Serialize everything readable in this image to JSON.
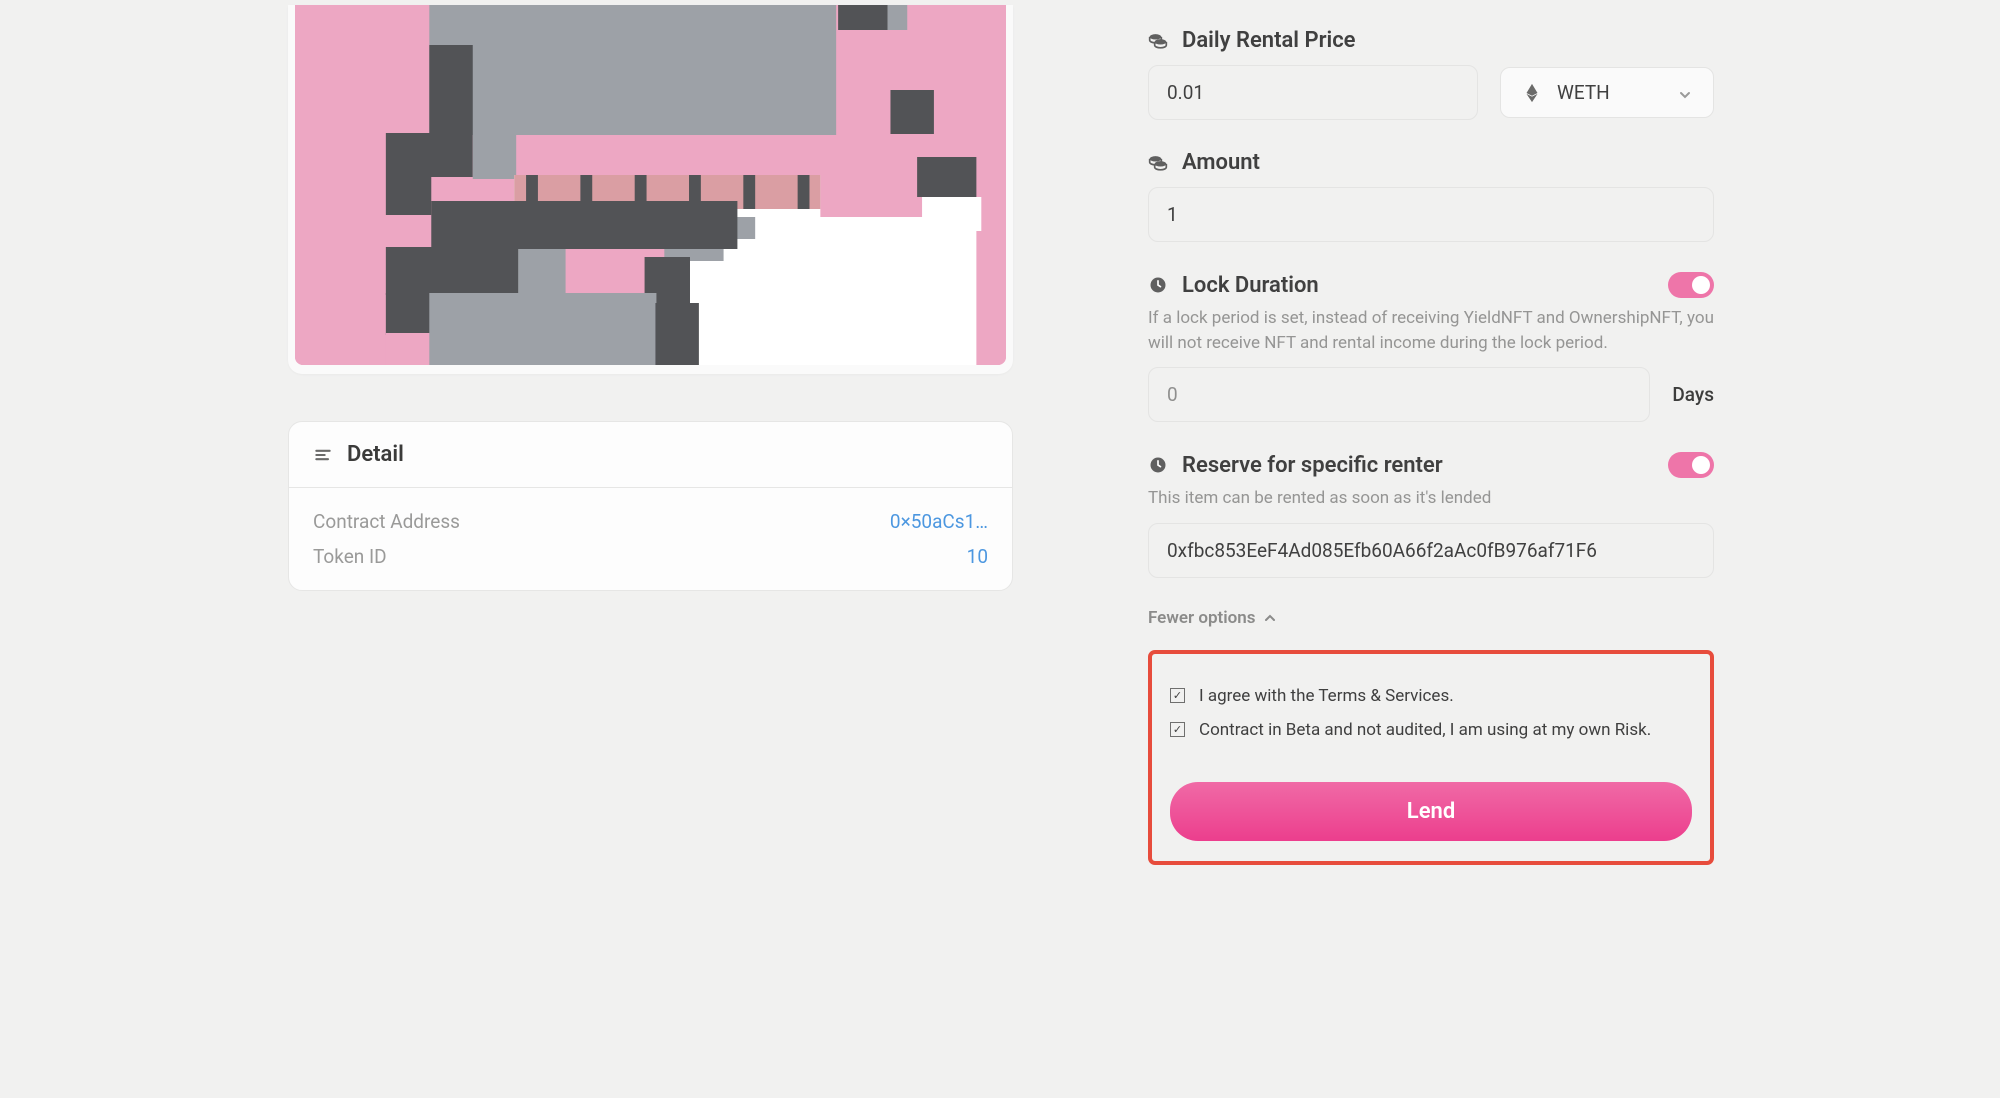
{
  "nft": {
    "bg": "#eda7c3"
  },
  "detail": {
    "title": "Detail",
    "contract_label": "Contract Address",
    "contract_value": "0×50aCs1…",
    "token_label": "Token ID",
    "token_value": "10"
  },
  "form": {
    "price_label": "Daily Rental Price",
    "price_value": "0.01",
    "currency": "WETH",
    "amount_label": "Amount",
    "amount_value": "1",
    "lock_label": "Lock Duration",
    "lock_help": "If a lock period is set, instead of receiving YieldNFT and OwnershipNFT, you will not receive NFT and rental income during the lock period.",
    "lock_placeholder": "0",
    "days_suffix": "Days",
    "reserve_label": "Reserve for specific renter",
    "reserve_help": "This item can be rented as soon as it's lended",
    "reserve_value": "0xfbc853EeF4Ad085Efb60A66f2aAc0fB976af71F6",
    "fewer_options": "Fewer options",
    "agree_terms": "I agree with the Terms & Services.",
    "agree_beta": "Contract in Beta and not audited, I am using at my own Risk.",
    "lend_button": "Lend"
  }
}
